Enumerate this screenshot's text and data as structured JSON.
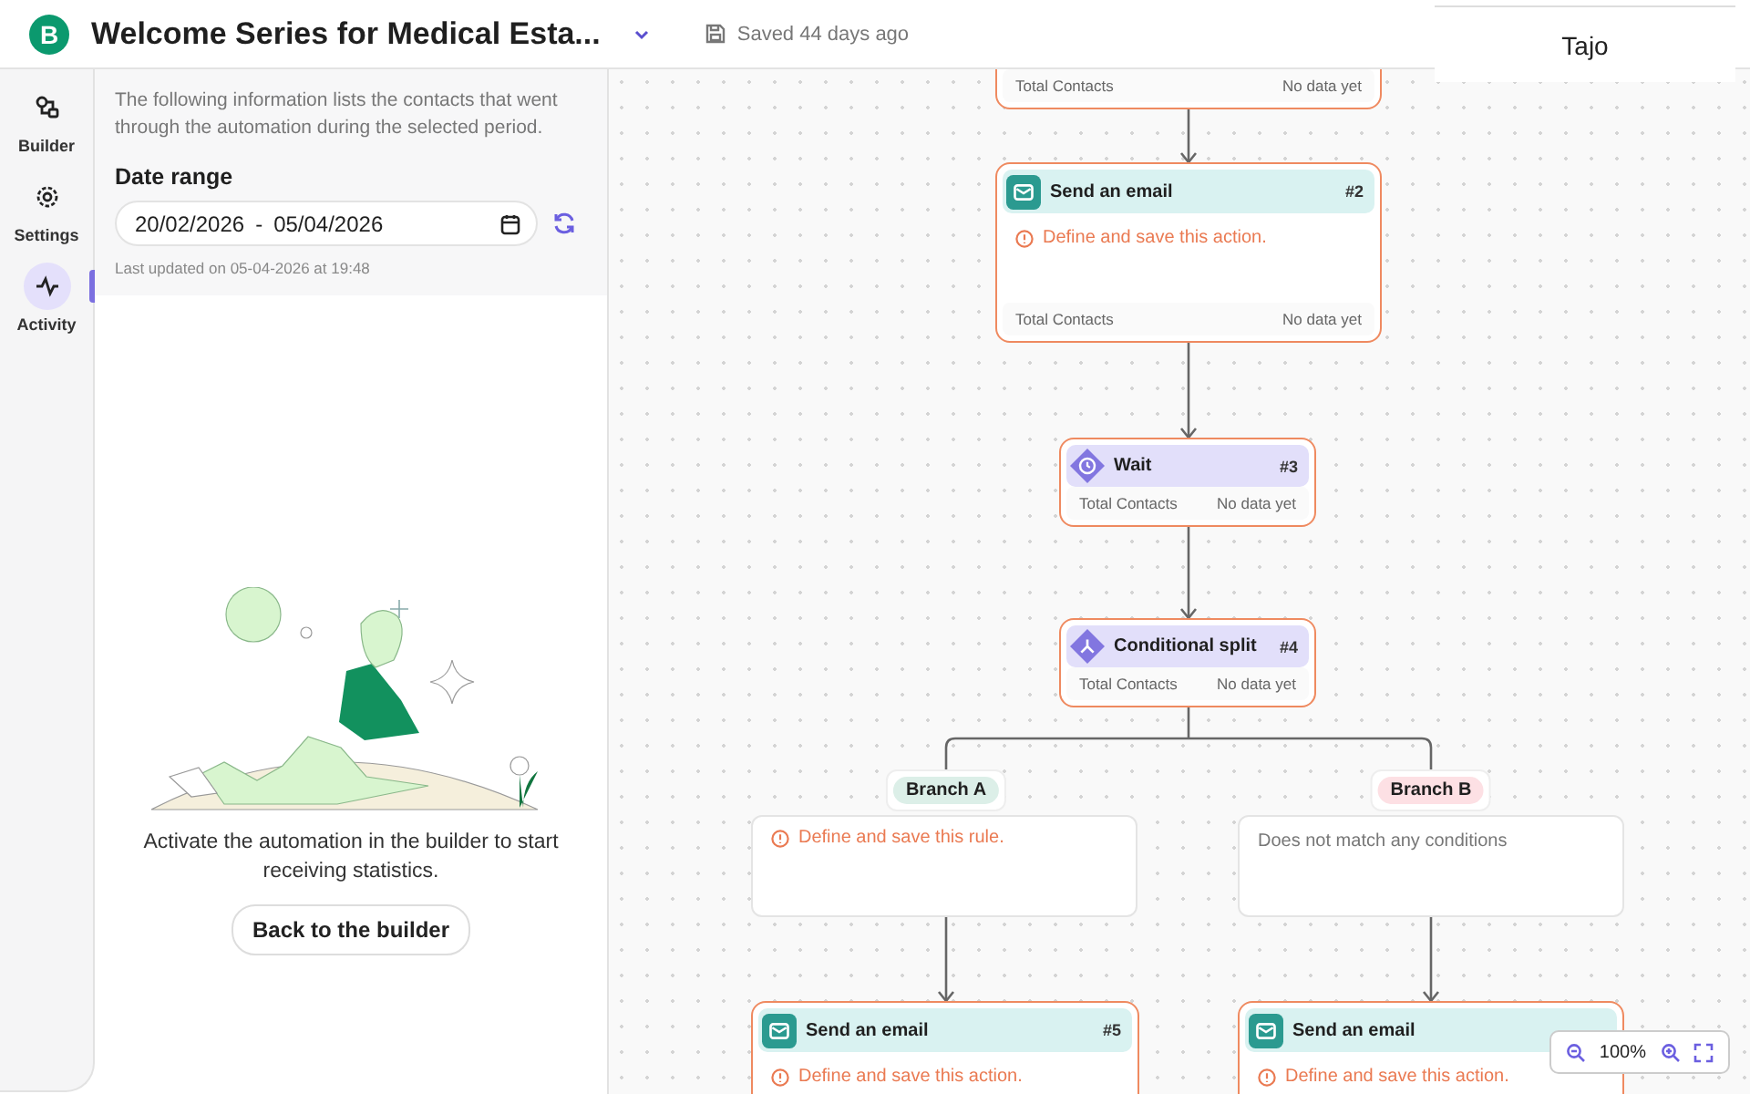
{
  "header": {
    "logo": "B",
    "title": "Welcome Series for Medical Esta...",
    "saved": "Saved 44 days ago"
  },
  "popup": {
    "label": "Tajo"
  },
  "nav": [
    {
      "label": "Builder",
      "kind": "builder",
      "selected": false
    },
    {
      "label": "Settings",
      "kind": "settings",
      "selected": false
    },
    {
      "label": "Activity",
      "kind": "activity",
      "selected": true
    }
  ],
  "activity": {
    "description": "The following information lists the contacts that went through the automation during the selected period.",
    "date_range_label": "Date range",
    "date_from": "20/02/2026",
    "date_separator": "-",
    "date_to": "05/04/2026",
    "last_updated": "Last updated on 05-04-2026 at 19:48",
    "empty_message": "Activate the automation in the builder to start receiving statistics.",
    "button": "Back to the builder"
  },
  "workflow": {
    "nodes": [
      {
        "kind": "partial",
        "stat_label": "Total Contacts",
        "stat_value": "No data yet"
      },
      {
        "kind": "email",
        "title": "Send an email",
        "number": "#2",
        "warning": "Define and save this action.",
        "stat_label": "Total Contacts",
        "stat_value": "No data yet"
      },
      {
        "kind": "wait",
        "title": "Wait",
        "number": "#3",
        "stat_label": "Total Contacts",
        "stat_value": "No data yet"
      },
      {
        "kind": "split",
        "title": "Conditional split",
        "number": "#4",
        "stat_label": "Total Contacts",
        "stat_value": "No data yet"
      },
      {
        "kind": "email",
        "title": "Send an email",
        "number": "#5",
        "warning": "Define and save this action."
      },
      {
        "kind": "email",
        "title": "Send an email",
        "warning": "Define and save this action."
      }
    ],
    "branches": [
      {
        "label": "Branch A",
        "color": "#dcefe8",
        "warning": "Define and save this rule."
      },
      {
        "label": "Branch B",
        "color": "#fde0e4",
        "note": "Does not match any conditions"
      }
    ],
    "zoom": {
      "level": "100%"
    }
  }
}
